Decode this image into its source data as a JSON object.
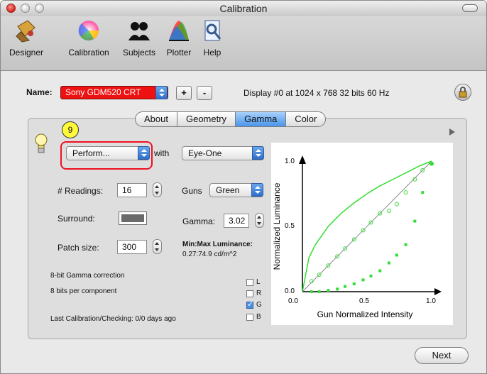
{
  "window": {
    "title": "Calibration"
  },
  "toolbar": {
    "items": [
      {
        "label": "Designer",
        "icon": "designer-icon"
      },
      {
        "label": "Calibration",
        "icon": "color-wheel-icon"
      },
      {
        "label": "Subjects",
        "icon": "subjects-icon"
      },
      {
        "label": "Plotter",
        "icon": "plotter-icon"
      },
      {
        "label": "Help",
        "icon": "help-icon"
      }
    ]
  },
  "name_row": {
    "label": "Name:",
    "selected": "Sony GDM520 CRT",
    "plus": "+",
    "minus": "-",
    "display_info": "Display #0 at 1024 x 768  32 bits  60 Hz"
  },
  "tabs": [
    {
      "label": "About",
      "active": false
    },
    {
      "label": "Geometry",
      "active": false
    },
    {
      "label": "Gamma",
      "active": true
    },
    {
      "label": "Color",
      "active": false
    }
  ],
  "gamma": {
    "badge": "9",
    "action_popup": "Perform...",
    "with_label": "with",
    "device_popup": "Eye-One",
    "readings_label": "# Readings:",
    "readings_value": "16",
    "guns_label": "Guns",
    "guns_value": "Green",
    "surround_label": "Surround:",
    "surround_color": "#6a6a6a",
    "gamma_label": "Gamma:",
    "gamma_value": "3.02",
    "patch_label": "Patch size:",
    "patch_value": "300",
    "minmax_label": "Min:Max Luminance:",
    "minmax_value": "0.27:74.9 cd/m^2",
    "info1": "8-bit Gamma correction",
    "info2": "8 bits per component",
    "last_calibration": "Last Calibration/Checking: 0/0 days ago",
    "checkboxes": [
      {
        "label": "L",
        "checked": false
      },
      {
        "label": "R",
        "checked": false
      },
      {
        "label": "G",
        "checked": true
      },
      {
        "label": "B",
        "checked": false
      }
    ]
  },
  "chart_data": {
    "type": "line",
    "title": "",
    "xlabel": "Gun Normalized Intensity",
    "ylabel": "Normalized Luminance",
    "xlim": [
      0,
      1
    ],
    "ylim": [
      0,
      1
    ],
    "xticks": [
      "0.0",
      "0.5",
      "1.0"
    ],
    "yticks": [
      "0.0",
      "0.5",
      "1.0"
    ],
    "grid": false,
    "series": [
      {
        "style": "line",
        "color": "#888888",
        "x": [
          0,
          1
        ],
        "y": [
          0,
          1
        ]
      },
      {
        "style": "line",
        "color": "#33dd33",
        "x": [
          0,
          0.05,
          0.1,
          0.2,
          0.3,
          0.4,
          0.5,
          0.6,
          0.7,
          0.8,
          0.9,
          1.0
        ],
        "y": [
          0,
          0.26,
          0.36,
          0.5,
          0.6,
          0.68,
          0.75,
          0.81,
          0.86,
          0.91,
          0.96,
          1.0
        ]
      },
      {
        "style": "circles",
        "color": "#33dd33",
        "x": [
          0.07,
          0.13,
          0.2,
          0.27,
          0.33,
          0.4,
          0.47,
          0.53,
          0.6,
          0.67,
          0.73,
          0.8,
          0.87,
          0.93,
          1.0
        ],
        "y": [
          0.08,
          0.13,
          0.2,
          0.27,
          0.33,
          0.4,
          0.47,
          0.53,
          0.6,
          0.62,
          0.67,
          0.76,
          0.86,
          0.93,
          0.98
        ]
      },
      {
        "style": "squares",
        "color": "#33dd33",
        "x": [
          0.07,
          0.13,
          0.2,
          0.27,
          0.33,
          0.4,
          0.47,
          0.53,
          0.6,
          0.67,
          0.73,
          0.8,
          0.87,
          0.93,
          1.0
        ],
        "y": [
          0.0,
          0.0,
          0.01,
          0.02,
          0.04,
          0.06,
          0.09,
          0.12,
          0.16,
          0.22,
          0.28,
          0.36,
          0.54,
          0.76,
          0.98
        ]
      }
    ]
  },
  "footer": {
    "next": "Next"
  },
  "colors": {
    "accent": "#4b95ea",
    "highlight": "#e11122",
    "curve": "#33dd33"
  }
}
